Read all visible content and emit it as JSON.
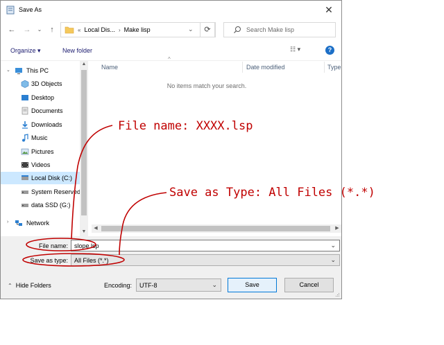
{
  "window": {
    "title": "Save As",
    "close_glyph": "✕"
  },
  "nav_buttons": {
    "back": "←",
    "forward": "→",
    "recent": "⌄",
    "up": "↑"
  },
  "address": {
    "crumbs": [
      "«",
      "Local Dis...",
      "›",
      "Make lisp"
    ],
    "dropdown": "⌄",
    "refresh": "⟳"
  },
  "search": {
    "placeholder": "Search Make lisp"
  },
  "toolbar": {
    "organize": "Organize ▾",
    "new_folder": "New folder",
    "views": "☷ ▾",
    "help": "?"
  },
  "nav_pane": {
    "items": [
      {
        "label": "This PC",
        "icon": "pc-icon"
      },
      {
        "label": "3D Objects",
        "icon": "cube-icon"
      },
      {
        "label": "Desktop",
        "icon": "desktop-icon"
      },
      {
        "label": "Documents",
        "icon": "documents-icon"
      },
      {
        "label": "Downloads",
        "icon": "download-icon"
      },
      {
        "label": "Music",
        "icon": "music-icon"
      },
      {
        "label": "Pictures",
        "icon": "pictures-icon"
      },
      {
        "label": "Videos",
        "icon": "videos-icon"
      },
      {
        "label": "Local Disk (C:)",
        "icon": "drive-icon",
        "selected": true
      },
      {
        "label": "System Reserved",
        "icon": "drive-icon"
      },
      {
        "label": "data SSD (G:)",
        "icon": "drive-icon"
      },
      {
        "label": "Network",
        "icon": "network-icon"
      }
    ]
  },
  "file_list": {
    "columns": [
      "Name",
      "Date modified",
      "Type"
    ],
    "sort_indicator": "^",
    "empty_message": "No items match your search."
  },
  "form": {
    "file_name_label": "File name:",
    "file_name_value": "slope.lsp",
    "save_type_label": "Save as type:",
    "save_type_value": "All Files  (*.*)",
    "encoding_label": "Encoding:",
    "encoding_value": "UTF-8",
    "hide_folders": "Hide Folders",
    "save": "Save",
    "cancel": "Cancel"
  },
  "annotations": {
    "file_name_note": "File name: XXXX.lsp",
    "save_type_note": "Save as Type: All Files (*.*)"
  },
  "colors": {
    "annotation": "#c00000",
    "selection": "#cce8ff",
    "accent": "#0078d7"
  }
}
